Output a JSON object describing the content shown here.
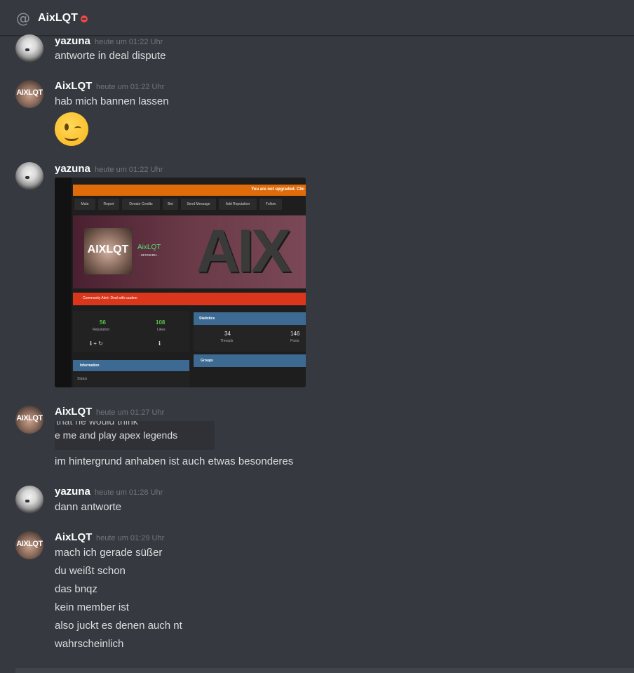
{
  "header": {
    "channel_icon": "at-sign-icon",
    "title": "AixLQT",
    "status": "do-not-disturb"
  },
  "messages": [
    {
      "author": "yazuna",
      "timestamp": "heute um 01:22 Uhr",
      "lines": [
        "antworte in deal dispute"
      ]
    },
    {
      "author": "AixLQT",
      "timestamp": "heute um 01:22 Uhr",
      "lines": [
        "hab mich bannen lassen"
      ],
      "emoji": "winking-face-emoji"
    },
    {
      "author": "yazuna",
      "timestamp": "heute um 01:22 Uhr",
      "attachment": {
        "banner_text": "You are not upgraded. Clic",
        "buttons": [
          "Mute",
          "Report",
          "Donate Credits",
          "Bet",
          "Send Message",
          "Add Reputation",
          "Follow"
        ],
        "profile_initials": "AIXLQT",
        "username": "AixLQT",
        "usertitle": "- ɴᴇᴛᴏʀᴜʙɪᴀ -",
        "big_text": "AIX",
        "alert": "Community Alert: Deal with caution",
        "reputation_value": "56",
        "reputation_label": "Reputation",
        "likes_value": "108",
        "likes_label": "Likes",
        "statistics_label": "Statistics",
        "threads_value": "34",
        "threads_label": "Threads",
        "posts_value": "146",
        "posts_label": "Posts",
        "groups_label": "Groups",
        "information_label": "Information",
        "status_label": "Status"
      }
    },
    {
      "author": "AixLQT",
      "timestamp": "heute um 01:27 Uhr",
      "snippet": {
        "line1": "that he would think",
        "line2": "e me and play apex legends"
      },
      "lines": [
        "im hintergrund anhaben ist auch etwas besonderes"
      ]
    },
    {
      "author": "yazuna",
      "timestamp": "heute um 01:28 Uhr",
      "lines": [
        "dann antworte"
      ]
    },
    {
      "author": "AixLQT",
      "timestamp": "heute um 01:29 Uhr",
      "lines": [
        "mach ich gerade süßer",
        "du weißt schon",
        "das bnqz",
        "kein member ist",
        "also juckt es denen auch nt",
        "wahrscheinlich"
      ]
    }
  ],
  "avatars": {
    "AixLQT_text": "AIXLQT"
  }
}
